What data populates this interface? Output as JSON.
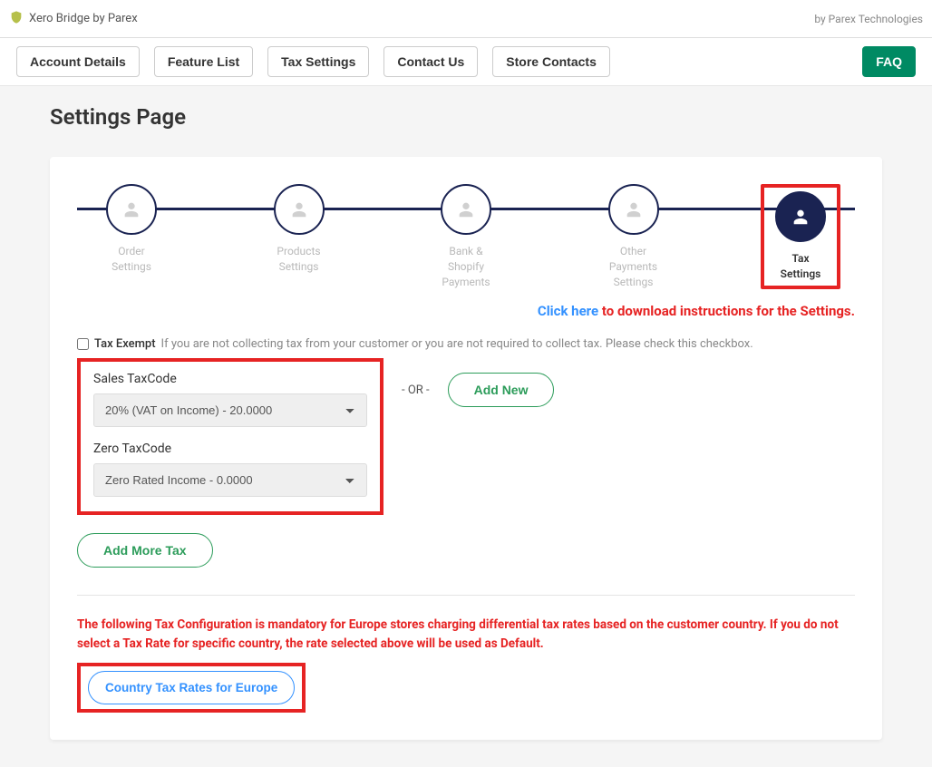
{
  "header": {
    "app_title": "Xero Bridge by Parex",
    "by_text": "by Parex Technologies"
  },
  "nav": {
    "account_details": "Account Details",
    "feature_list": "Feature List",
    "tax_settings": "Tax Settings",
    "contact_us": "Contact Us",
    "store_contacts": "Store Contacts",
    "faq": "FAQ"
  },
  "page": {
    "title": "Settings Page"
  },
  "steps": {
    "s1_line1": "Order",
    "s1_line2": "Settings",
    "s2_line1": "Products",
    "s2_line2": "Settings",
    "s3_line1": "Bank &",
    "s3_line2": "Shopify",
    "s3_line3": "Payments",
    "s4_line1": "Other",
    "s4_line2": "Payments",
    "s4_line3": "Settings",
    "s5_line1": "Tax",
    "s5_line2": "Settings"
  },
  "download": {
    "link": "Click here",
    "text": " to download instructions for the Settings."
  },
  "tax_exempt": {
    "label": "Tax Exempt",
    "hint": "If you are not collecting tax from your customer or you are not required to collect tax. Please check this checkbox."
  },
  "sales_tax": {
    "label": "Sales TaxCode",
    "value": "20% (VAT on Income) - 20.0000"
  },
  "zero_tax": {
    "label": "Zero TaxCode",
    "value": "Zero Rated Income - 0.0000"
  },
  "or_text": "- OR -",
  "add_new": "Add New",
  "add_more_tax": "Add More Tax",
  "mandatory_text": "The following Tax Configuration is mandatory for Europe stores charging differential tax rates based on the customer country. If you do not select a Tax Rate for specific country, the rate selected above will be used as Default.",
  "europe_btn": "Country Tax Rates for Europe"
}
